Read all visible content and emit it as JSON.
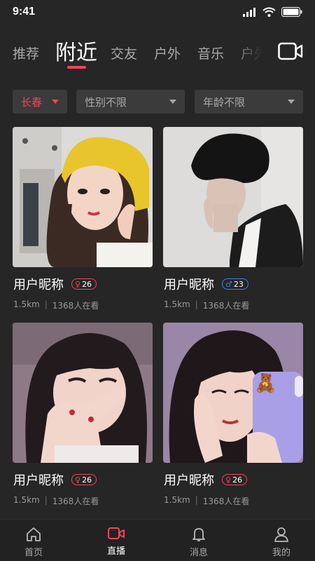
{
  "status_bar": {
    "time": "9:41"
  },
  "tabs": [
    {
      "label": "推荐",
      "active": false
    },
    {
      "label": "附近",
      "active": true
    },
    {
      "label": "交友",
      "active": false
    },
    {
      "label": "户外",
      "active": false
    },
    {
      "label": "音乐",
      "active": false
    },
    {
      "label": "户外",
      "active": false
    }
  ],
  "filters": {
    "city": "长春",
    "gender": "性别不限",
    "age": "年龄不限"
  },
  "cards": [
    {
      "name": "用户昵称",
      "gender": "female",
      "age": "26",
      "distance": "1.5km",
      "viewers": "1368人在看"
    },
    {
      "name": "用户昵称",
      "gender": "male",
      "age": "23",
      "distance": "1.5km",
      "viewers": "1368人在看"
    },
    {
      "name": "用户昵称",
      "gender": "female",
      "age": "26",
      "distance": "1.5km",
      "viewers": "1368人在看"
    },
    {
      "name": "用户昵称",
      "gender": "female",
      "age": "26",
      "distance": "1.5km",
      "viewers": "1368人在看"
    }
  ],
  "bottom_nav": [
    {
      "label": "首页",
      "icon": "home-icon",
      "active": false
    },
    {
      "label": "直播",
      "icon": "live-camera-icon",
      "active": true
    },
    {
      "label": "消息",
      "icon": "bell-icon",
      "active": false
    },
    {
      "label": "我的",
      "icon": "user-icon",
      "active": false
    }
  ],
  "colors": {
    "accent": "#f0455b",
    "male": "#3f7ee8",
    "background": "#262626"
  }
}
